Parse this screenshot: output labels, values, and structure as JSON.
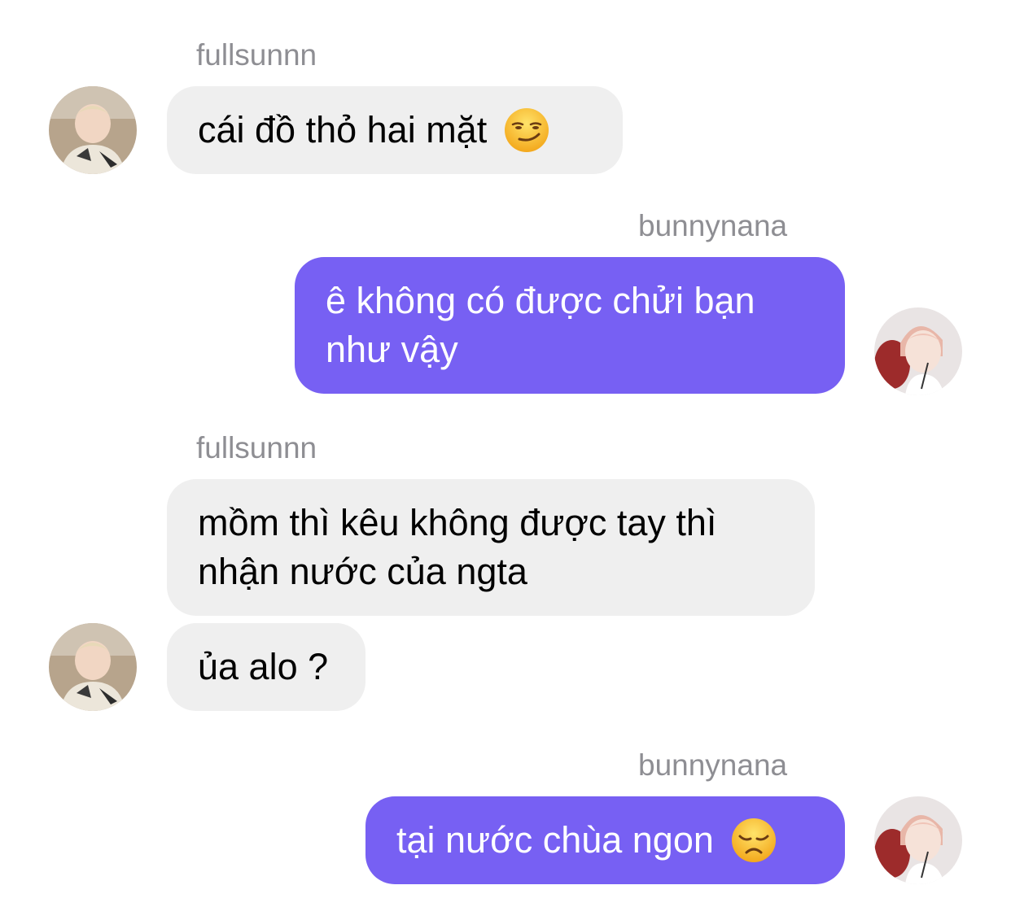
{
  "messages": [
    {
      "sender": "fullsunnn",
      "direction": "incoming",
      "text": "cái đồ thỏ hai mặt",
      "emoji": "smirking-face"
    },
    {
      "sender": "bunnynana",
      "direction": "outgoing",
      "lines": [
        "ê không có được chửi bạn",
        "như vậy"
      ]
    },
    {
      "sender": "fullsunnn",
      "direction": "incoming",
      "lines": [
        "mồm thì kêu không được tay thì",
        "nhận nước của ngta"
      ]
    },
    {
      "direction": "incoming",
      "text": "ủa alo ?"
    },
    {
      "sender": "bunnynana",
      "direction": "outgoing",
      "text": "tại nước chùa ngon",
      "emoji": "disappointed-face"
    }
  ],
  "colors": {
    "outgoing_bubble": "#7760f3",
    "incoming_bubble": "#efefef",
    "sender_name": "#8e8e93",
    "background": "#ffffff"
  }
}
